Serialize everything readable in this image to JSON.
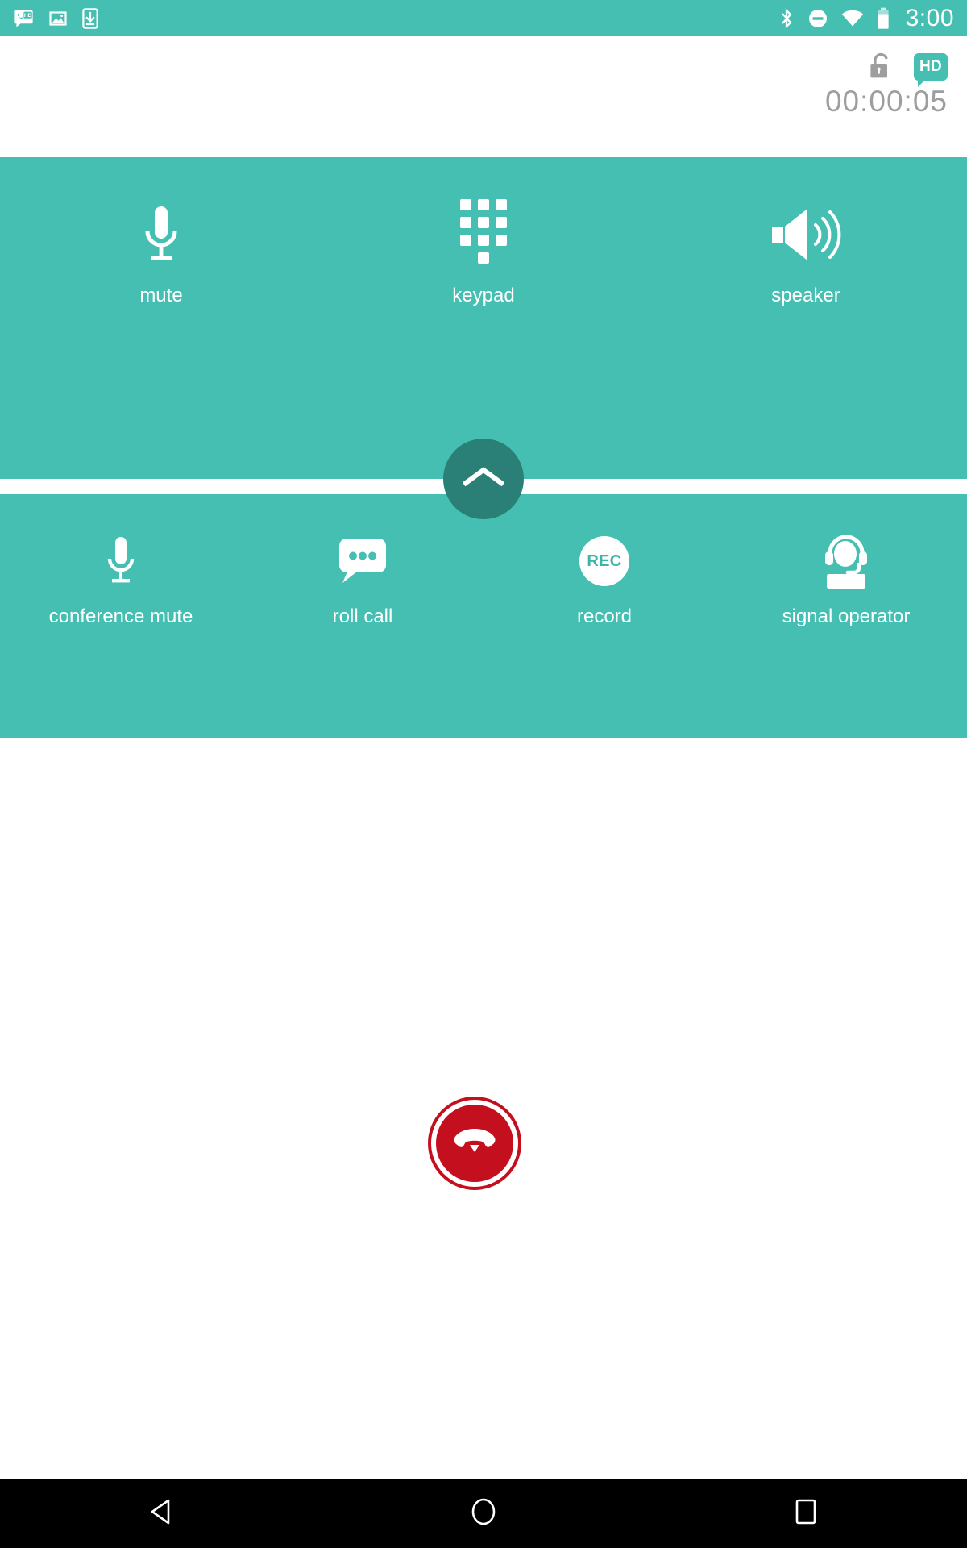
{
  "status_bar": {
    "icons_left": [
      {
        "name": "hd-call-icon",
        "label": "HD call"
      },
      {
        "name": "screenshot-image-icon",
        "label": "Screenshot"
      },
      {
        "name": "download-to-device-icon",
        "label": "Download"
      }
    ],
    "icons_right": [
      {
        "name": "bluetooth-icon",
        "label": "Bluetooth"
      },
      {
        "name": "do-not-disturb-icon",
        "label": "Do not disturb"
      },
      {
        "name": "wifi-icon",
        "label": "Wi-Fi"
      },
      {
        "name": "battery-icon",
        "label": "Battery"
      }
    ],
    "time": "3:00",
    "background_color": "#45bfb2"
  },
  "header": {
    "lock_icon": "unlock-icon",
    "hd_badge_label": "HD",
    "call_timer": "00:00:05",
    "timer_color": "#9e9e9e"
  },
  "controls": {
    "primary_row": [
      {
        "label": "mute",
        "icon": "microphone-icon"
      },
      {
        "label": "keypad",
        "icon": "keypad-icon"
      },
      {
        "label": "speaker",
        "icon": "speaker-icon"
      }
    ],
    "secondary_row": [
      {
        "label": "conference mute",
        "icon": "microphone-icon"
      },
      {
        "label": "roll call",
        "icon": "chat-bubble-dots-icon"
      },
      {
        "label": "record",
        "icon": "rec-circle-icon"
      },
      {
        "label": "signal operator",
        "icon": "headset-operator-icon"
      }
    ],
    "expand_button": {
      "icon": "chevron-up-icon",
      "color": "#2a8077"
    },
    "panel_color": "#45bfb2"
  },
  "end_call": {
    "icon": "end-call-handset-icon",
    "color": "#c40f1f"
  },
  "nav_bar": {
    "buttons": [
      {
        "name": "back-button",
        "icon": "triangle-left-icon"
      },
      {
        "name": "home-button",
        "icon": "circle-icon"
      },
      {
        "name": "recents-button",
        "icon": "square-icon"
      }
    ],
    "background_color": "#000000"
  }
}
